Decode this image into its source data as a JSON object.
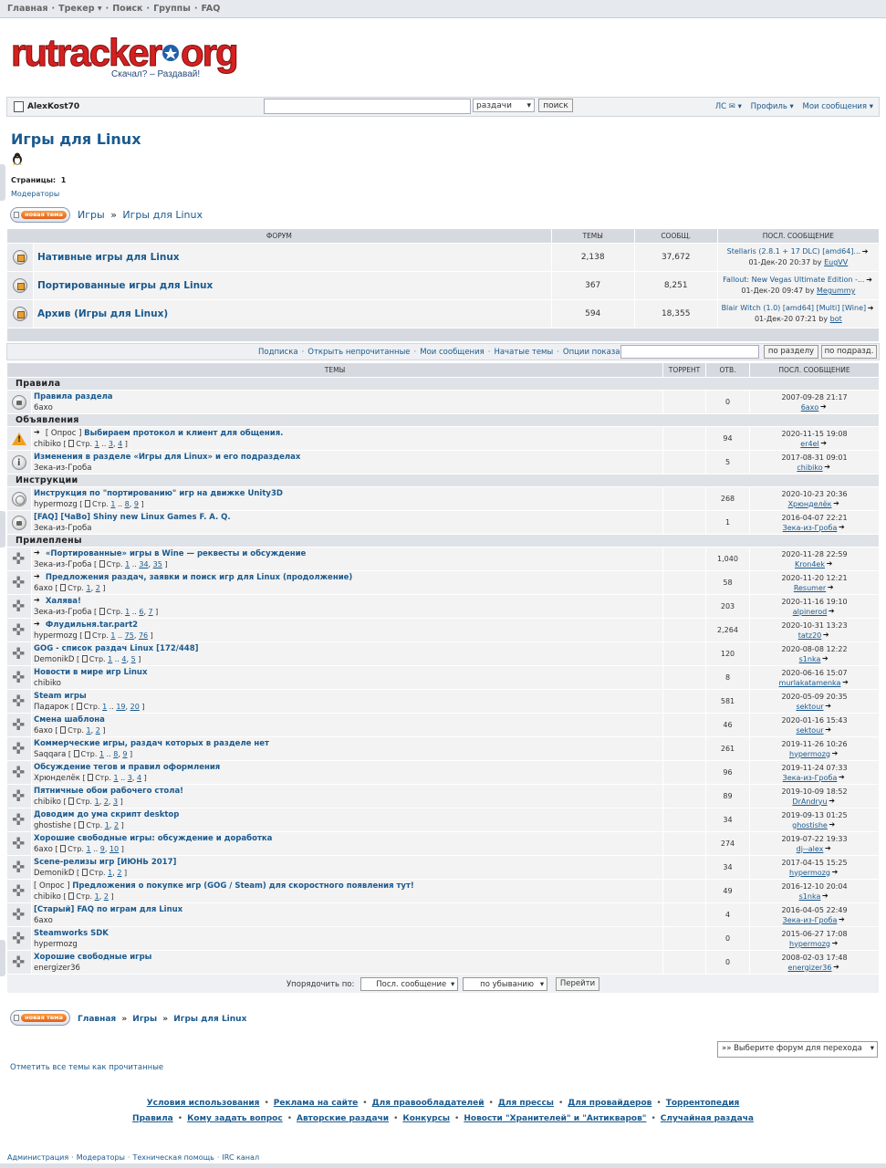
{
  "topnav": {
    "items": [
      "Главная",
      "Трекер ▾",
      "Поиск",
      "Группы",
      "FAQ"
    ]
  },
  "logo": {
    "brand_left": "rutracker",
    "brand_right": "org",
    "slogan": "Скачал? – Раздавай!"
  },
  "userbar": {
    "username": "AlexKost70",
    "search_select": "раздачи",
    "search_button": "поиск",
    "links": [
      "ЛС ✉ ▾",
      "Профиль ▾",
      "Мои сообщения ▾"
    ]
  },
  "page": {
    "title": "Игры для Linux",
    "pages_label": "Страницы:",
    "pages_value": "1",
    "moderators": "Модераторы",
    "new_topic": "новая тема",
    "breadcrumb_top": [
      "Игры",
      "Игры для Linux"
    ],
    "breadcrumb_bottom": [
      "Главная",
      "Игры",
      "Игры для Linux"
    ]
  },
  "forum_table": {
    "headers": [
      "ФОРУМ",
      "ТЕМЫ",
      "СООБЩ.",
      "ПОСЛ. СООБЩЕНИЕ"
    ],
    "rows": [
      {
        "name": "Нативные игры для Linux",
        "topics": "2,138",
        "posts": "37,672",
        "last_title": "Stellaris (2.8.1 + 17 DLC) [amd64]...",
        "last_date": "01-Дек-20 20:37 by",
        "last_user": "EugVV"
      },
      {
        "name": "Портированные игры для Linux",
        "topics": "367",
        "posts": "8,251",
        "last_title": "Fallout: New Vegas Ultimate Edition -...",
        "last_date": "01-Дек-20 09:47 by",
        "last_user": "Megummy"
      },
      {
        "name": "Архив (Игры для Linux)",
        "topics": "594",
        "posts": "18,355",
        "last_title": "Blair Witch (1.0) [amd64] [Multi] [Wine]",
        "last_date": "01-Дек-20 07:21 by",
        "last_user": "bot"
      }
    ]
  },
  "options_bar": {
    "links": [
      "Подписка",
      "Открыть непрочитанные",
      "Мои сообщения",
      "Начатые темы",
      "Опции показа ▽"
    ],
    "btn_section": "по разделу",
    "btn_subsection": "по подразд."
  },
  "topics_table": {
    "headers": [
      "ТЕМЫ",
      "ТОРРЕНТ",
      "ОТВ.",
      "ПОСЛ. СООБЩЕНИЕ"
    ],
    "page_prefix": "Стр.",
    "sections": [
      {
        "title": "Правила",
        "topics": [
          {
            "icon": "lock",
            "new": false,
            "prefix": "",
            "title": "Правила раздела",
            "author": "6ахо",
            "pages": [],
            "replies": "0",
            "last_date": "2007-09-28 21:17",
            "last_user": "6ахо"
          }
        ]
      },
      {
        "title": "Объявления",
        "topics": [
          {
            "icon": "warn",
            "new": true,
            "prefix": "[ Опрос ] ",
            "title": "Выбираем протокол и клиент для общения.",
            "author": "chibiko",
            "pages": [
              "1",
              "..",
              "3",
              "4"
            ],
            "replies": "94",
            "last_date": "2020-11-15 19:08",
            "last_user": "er4el"
          },
          {
            "icon": "info",
            "new": false,
            "prefix": "",
            "title": "Изменения в разделе «Игры для Linux» и его подразделах",
            "author": "Зека-из-Гроба",
            "pages": [],
            "replies": "5",
            "last_date": "2017-08-31 09:01",
            "last_user": "chibiko"
          }
        ]
      },
      {
        "title": "Инструкции",
        "topics": [
          {
            "icon": "poll",
            "new": false,
            "prefix": "",
            "title": "Инструкция по \"портированию\" игр на движке Unity3D",
            "author": "hypermozg",
            "pages": [
              "1",
              "..",
              "8",
              "9"
            ],
            "replies": "268",
            "last_date": "2020-10-23 20:36",
            "last_user": "Хрюнделёк"
          },
          {
            "icon": "lock",
            "new": false,
            "prefix": "",
            "title": "[FAQ] [ЧаВо] Shiny new Linux Games F. A. Q.",
            "author": "Зека-из-Гроба",
            "pages": [],
            "replies": "1",
            "last_date": "2016-04-07 22:21",
            "last_user": "Зека-из-Гроба"
          }
        ]
      },
      {
        "title": "Прилеплены",
        "topics": [
          {
            "icon": "sticky",
            "new": true,
            "prefix": "",
            "title": "«Портированные» игры в Wine — реквесты и обсуждение",
            "author": "Зека-из-Гроба",
            "pages": [
              "1",
              "..",
              "34",
              "35"
            ],
            "replies": "1,040",
            "last_date": "2020-11-28 22:59",
            "last_user": "Kron4ek"
          },
          {
            "icon": "sticky",
            "new": true,
            "prefix": "",
            "title": "Предложения раздач, заявки и поиск игр для Linux (продолжение)",
            "author": "6ахо",
            "pages": [
              "1",
              "2"
            ],
            "replies": "58",
            "last_date": "2020-11-20 12:21",
            "last_user": "Resumer"
          },
          {
            "icon": "sticky",
            "new": true,
            "prefix": "",
            "title": "Халява!",
            "author": "Зека-из-Гроба",
            "pages": [
              "1",
              "..",
              "6",
              "7"
            ],
            "replies": "203",
            "last_date": "2020-11-16 19:10",
            "last_user": "alpinerod"
          },
          {
            "icon": "sticky",
            "new": true,
            "prefix": "",
            "title": "Флудильня.tar.part2",
            "author": "hypermozg",
            "pages": [
              "1",
              "..",
              "75",
              "76"
            ],
            "replies": "2,264",
            "last_date": "2020-10-31 13:23",
            "last_user": "tatz20"
          },
          {
            "icon": "sticky",
            "new": false,
            "prefix": "",
            "title": "GOG - список раздач Linux [172/448]",
            "author": "DemonikD",
            "pages": [
              "1",
              "..",
              "4",
              "5"
            ],
            "replies": "120",
            "last_date": "2020-08-08 12:22",
            "last_user": "s1nka"
          },
          {
            "icon": "sticky",
            "new": false,
            "prefix": "",
            "title": "Новости в мире игр Linux",
            "author": "chibiko",
            "pages": [],
            "replies": "8",
            "last_date": "2020-06-16 15:07",
            "last_user": "murlakatamenka"
          },
          {
            "icon": "sticky",
            "new": false,
            "prefix": "",
            "title": "Steam игры",
            "author": "Падарок",
            "pages": [
              "1",
              "..",
              "19",
              "20"
            ],
            "replies": "581",
            "last_date": "2020-05-09 20:35",
            "last_user": "sektour"
          },
          {
            "icon": "sticky",
            "new": false,
            "prefix": "",
            "title": "Смена шаблона",
            "author": "6ахо",
            "pages": [
              "1",
              "2"
            ],
            "replies": "46",
            "last_date": "2020-01-16 15:43",
            "last_user": "sektour"
          },
          {
            "icon": "sticky",
            "new": false,
            "prefix": "",
            "title": "Коммерческие игры, раздач которых в разделе нет",
            "author": "Saqqara",
            "pages": [
              "1",
              "..",
              "8",
              "9"
            ],
            "replies": "261",
            "last_date": "2019-11-26 10:26",
            "last_user": "hypermozg"
          },
          {
            "icon": "sticky",
            "new": false,
            "prefix": "",
            "title": "Обсуждение тегов и правил оформления",
            "author": "Хрюнделёк",
            "pages": [
              "1",
              "..",
              "3",
              "4"
            ],
            "replies": "96",
            "last_date": "2019-11-24 07:33",
            "last_user": "Зека-из-Гроба"
          },
          {
            "icon": "sticky",
            "new": false,
            "prefix": "",
            "title": "Пятничные обои рабочего стола!",
            "author": "chibiko",
            "pages": [
              "1",
              "2",
              "3"
            ],
            "replies": "89",
            "last_date": "2019-10-09 18:52",
            "last_user": "DrAndryu"
          },
          {
            "icon": "sticky",
            "new": false,
            "prefix": "",
            "title": "Доводим до ума скрипт desktop",
            "author": "ghostishe",
            "pages": [
              "1",
              "2"
            ],
            "replies": "34",
            "last_date": "2019-09-13 01:25",
            "last_user": "ghostishe"
          },
          {
            "icon": "sticky",
            "new": false,
            "prefix": "",
            "title": "Хорошие свободные игры: обсуждение и доработка",
            "author": "6ахо",
            "pages": [
              "1",
              "..",
              "9",
              "10"
            ],
            "replies": "274",
            "last_date": "2019-07-22 19:33",
            "last_user": "dj--alex"
          },
          {
            "icon": "sticky",
            "new": false,
            "prefix": "",
            "title": "Scene-релизы игр [ИЮНЬ 2017]",
            "author": "DemonikD",
            "pages": [
              "1",
              "2"
            ],
            "replies": "34",
            "last_date": "2017-04-15 15:25",
            "last_user": "hypermozg"
          },
          {
            "icon": "sticky",
            "new": false,
            "prefix": "[ Опрос ] ",
            "title": "Предложения о покупке игр (GOG / Steam) для скоростного появления тут!",
            "author": "chibiko",
            "pages": [
              "1",
              "2"
            ],
            "replies": "49",
            "last_date": "2016-12-10 20:04",
            "last_user": "s1nka"
          },
          {
            "icon": "sticky",
            "new": false,
            "prefix": "",
            "title": "[Старый] FAQ по играм для Linux",
            "author": "6ахо",
            "pages": [],
            "replies": "4",
            "last_date": "2016-04-05 22:49",
            "last_user": "Зека-из-Гроба"
          },
          {
            "icon": "sticky",
            "new": false,
            "prefix": "",
            "title": "Steamworks SDK",
            "author": "hypermozg",
            "pages": [],
            "replies": "0",
            "last_date": "2015-06-27 17:08",
            "last_user": "hypermozg"
          },
          {
            "icon": "sticky",
            "new": false,
            "prefix": "",
            "title": "Хорошие свободные игры",
            "author": "energizer36",
            "pages": [],
            "replies": "0",
            "last_date": "2008-02-03 17:48",
            "last_user": "energizer36"
          }
        ]
      }
    ]
  },
  "sort_bar": {
    "label": "Упорядочить по:",
    "sort_by": "Посл. сообщение",
    "order": "по убыванию",
    "go": "Перейти"
  },
  "jump_select": "»» Выберите форум для перехода",
  "mark_all": "Отметить все темы как прочитанные",
  "footer_line1": [
    "Условия использования",
    "Реклама на сайте",
    "Для правообладателей",
    "Для прессы",
    "Для провайдеров",
    "Торрентопедия"
  ],
  "footer_line2": [
    "Правила",
    "Кому задать вопрос",
    "Авторские раздачи",
    "Конкурсы",
    "Новости \"Хранителей\" и \"Антикваров\"",
    "Случайная раздача"
  ],
  "bottom_links": [
    "Администрация",
    "Модераторы",
    "Техническая помощь",
    "IRC канал"
  ],
  "colors": {
    "link": "#1a5a8f",
    "header_bg": "#d6dae0",
    "logo_red": "#d62020",
    "logo_blue": "#1e5fa8"
  }
}
